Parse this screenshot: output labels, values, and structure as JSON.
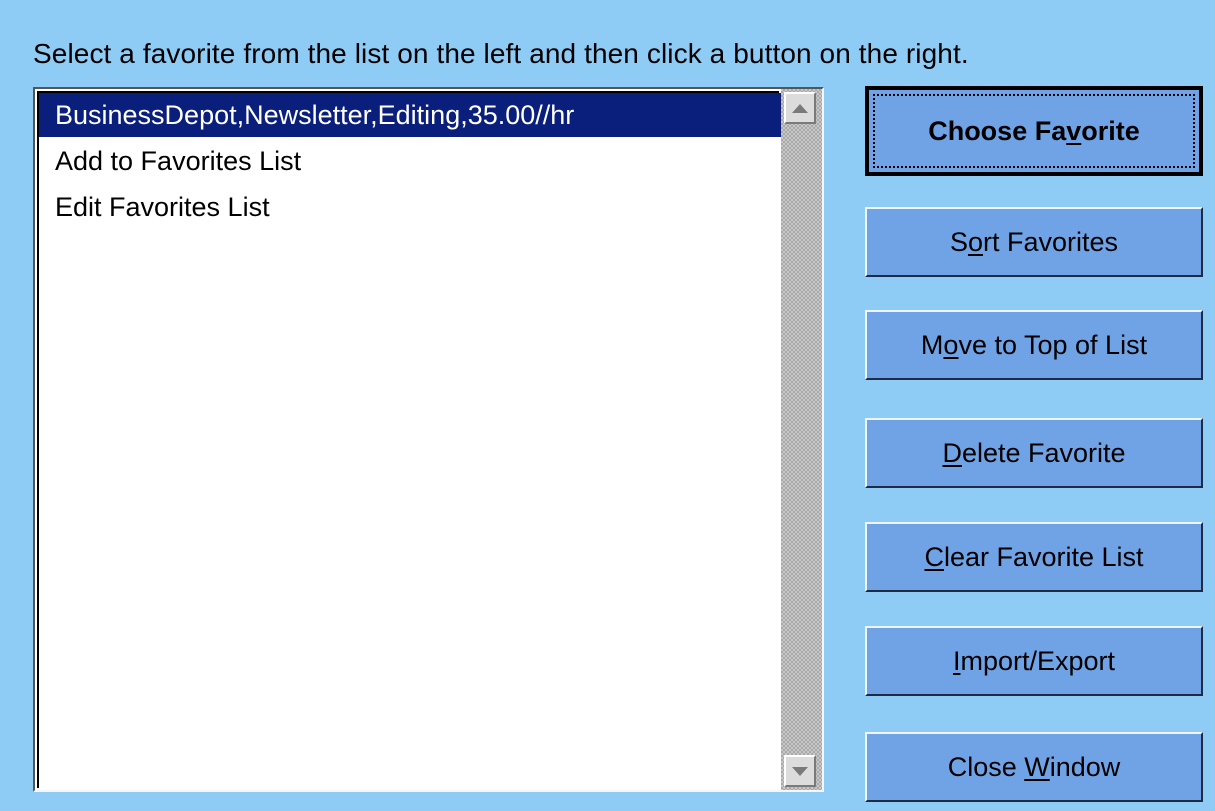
{
  "instruction": "Select a favorite from the list on the left and then click a button on the right.",
  "list": {
    "items": [
      {
        "label": "BusinessDepot,Newsletter,Editing,35.00//hr",
        "selected": true
      },
      {
        "label": "Add to Favorites List",
        "selected": false
      },
      {
        "label": "Edit Favorites List",
        "selected": false
      }
    ]
  },
  "buttons": {
    "choose": {
      "pre": "Choose Fa",
      "mn": "v",
      "post": "orite"
    },
    "sort": {
      "pre": "S",
      "mn": "o",
      "post": "rt Favorites"
    },
    "move": {
      "pre": "M",
      "mn": "o",
      "post": "ve to Top of List"
    },
    "delete": {
      "pre": "",
      "mn": "D",
      "post": "elete Favorite"
    },
    "clear": {
      "pre": "",
      "mn": "C",
      "post": "lear Favorite List"
    },
    "import": {
      "pre": "",
      "mn": "I",
      "post": "mport/Export"
    },
    "close": {
      "pre": "Close ",
      "mn": "W",
      "post": "indow"
    }
  },
  "colors": {
    "background": "#8ecbf5",
    "selection": "#0a1f7c",
    "button": "#6fa3e6"
  }
}
